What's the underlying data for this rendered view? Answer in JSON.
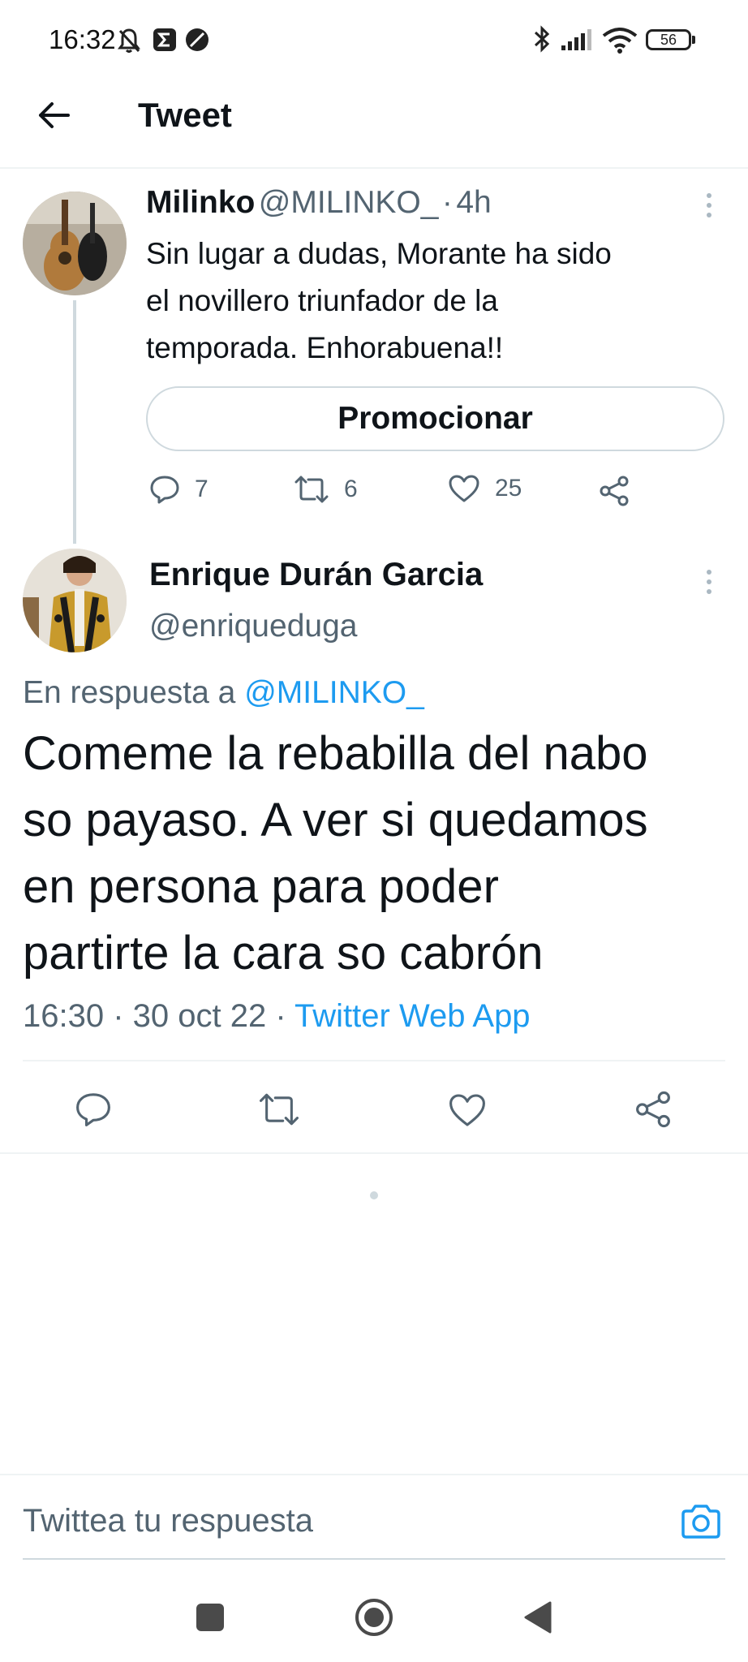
{
  "status_bar": {
    "time": "16:32",
    "battery": "56",
    "icons": [
      "bell-off-icon",
      "sigma-icon",
      "circle-slash-icon",
      "bluetooth-icon",
      "signal-icon",
      "wifi-icon",
      "battery-icon"
    ]
  },
  "header": {
    "back_icon": "arrow-left-icon",
    "title": "Tweet"
  },
  "parent_tweet": {
    "author_name": "Milinko",
    "author_handle": "@MILINKO_",
    "separator": "·",
    "time_ago": "4h",
    "text_lines": [
      "Sin lugar a dudas, Morante ha sido",
      "el novillero triunfador de la",
      "temporada. Enhorabuena!!"
    ],
    "promote_label": "Promocionar",
    "replies": "7",
    "retweets": "6",
    "likes": "25"
  },
  "main_tweet": {
    "author_name": "Enrique Durán Garcia",
    "author_handle": "@enriqueduga",
    "reply_prefix": "En respuesta a",
    "reply_to": "@MILINKO_",
    "text_lines": [
      "Comeme la rebabilla del nabo",
      "so payaso. A ver si quedamos",
      "en persona para poder",
      "partirte la cara so cabrón"
    ],
    "timestamp": "16:30 · 30 oct 22 ·",
    "source": "Twitter Web App"
  },
  "reply_bar": {
    "placeholder": "Twittea tu respuesta",
    "camera_icon": "camera-icon"
  },
  "nav_bar": {
    "icons": [
      "square-icon",
      "home-circle-icon",
      "back-triangle-icon"
    ]
  },
  "colors": {
    "link": "#1d9bf0",
    "secondary_text": "#536471",
    "primary_text": "#0f1419",
    "divider": "#eff3f4"
  }
}
